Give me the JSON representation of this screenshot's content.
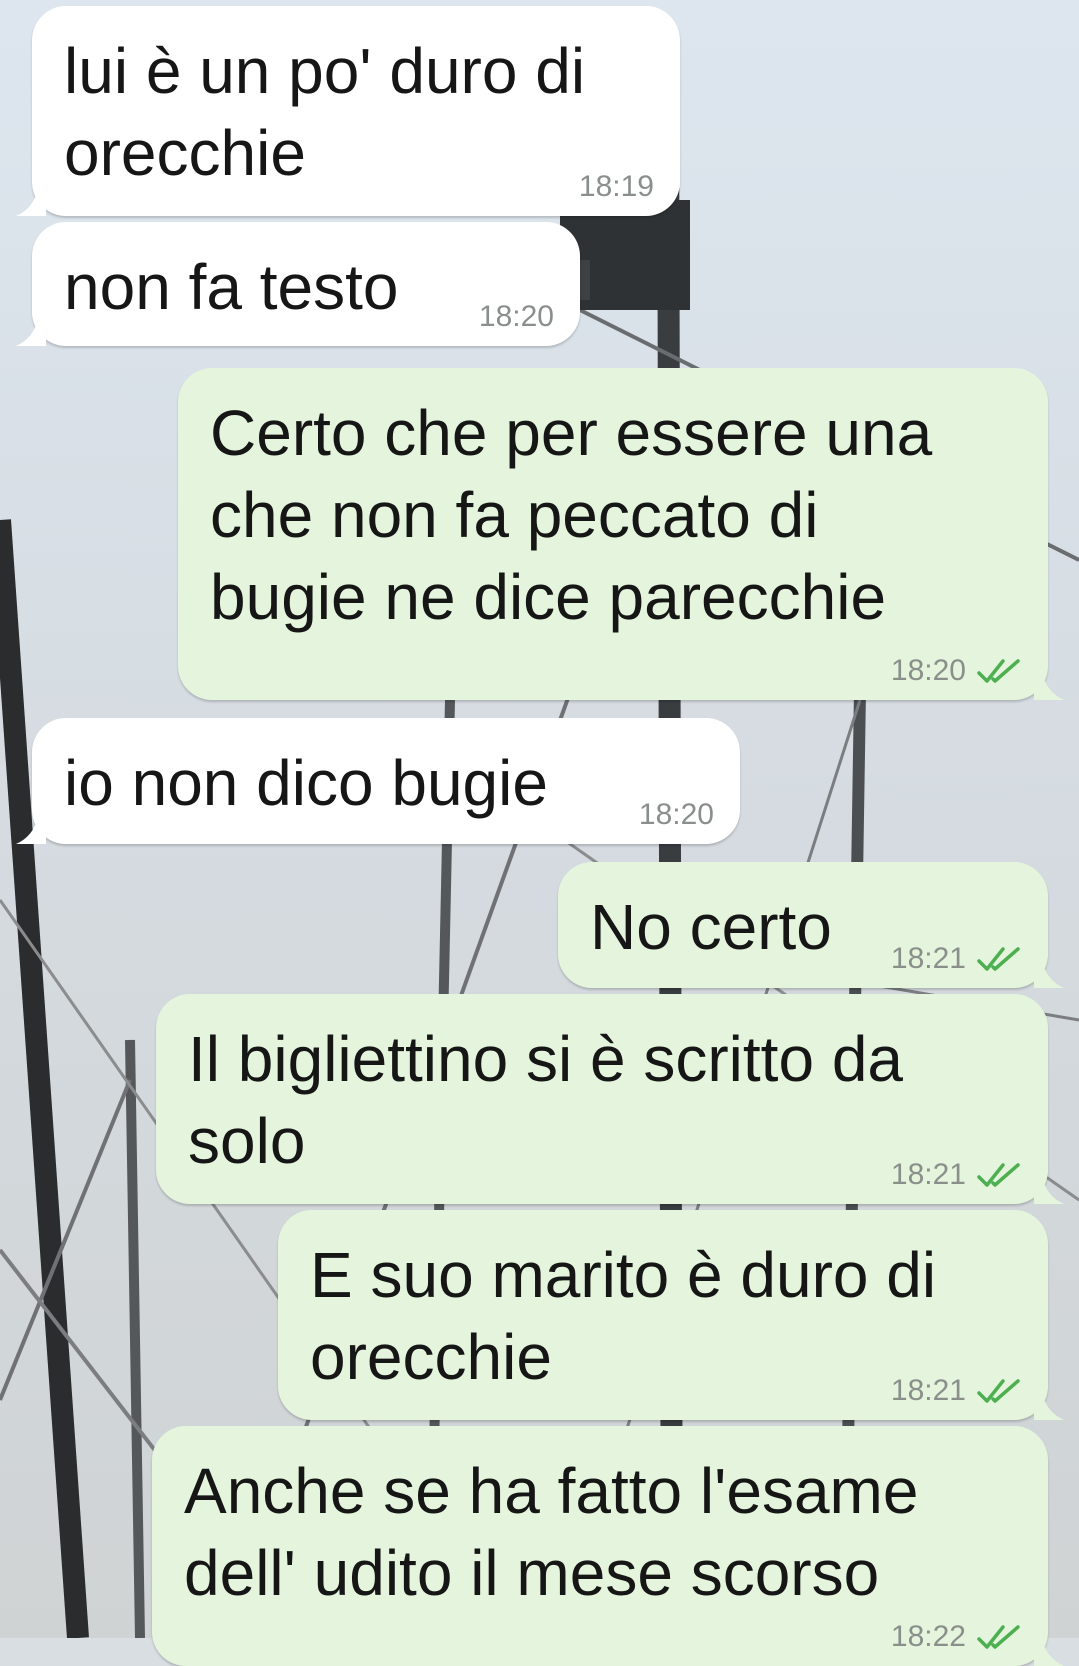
{
  "colors": {
    "incoming_bubble": "#ffffff",
    "outgoing_bubble": "#e5f5dd",
    "timestamp": "#8a8f8c",
    "read_ticks": "#4caf50"
  },
  "messages": [
    {
      "direction": "in",
      "text": "lui è un po' duro di\norecchie",
      "time": "18:19",
      "read_icon": ""
    },
    {
      "direction": "in",
      "text": "non fa testo",
      "time": "18:20",
      "read_icon": ""
    },
    {
      "direction": "out",
      "text": "Certo che per essere una\nche non fa peccato di\nbugie ne dice parecchie",
      "time": "18:20",
      "read_icon": "double-check-icon"
    },
    {
      "direction": "in",
      "text": "io non dico bugie",
      "time": "18:20",
      "read_icon": ""
    },
    {
      "direction": "out",
      "text": "No certo",
      "time": "18:21",
      "read_icon": "double-check-icon"
    },
    {
      "direction": "out",
      "text": "Il bigliettino si è scritto da\nsolo",
      "time": "18:21",
      "read_icon": "double-check-icon"
    },
    {
      "direction": "out",
      "text": "E suo marito è duro di\norecchie",
      "time": "18:21",
      "read_icon": "double-check-icon"
    },
    {
      "direction": "out",
      "text": "Anche se ha fatto l'esame\ndell' udito il mese scorso",
      "time": "18:22",
      "read_icon": "double-check-icon"
    }
  ]
}
